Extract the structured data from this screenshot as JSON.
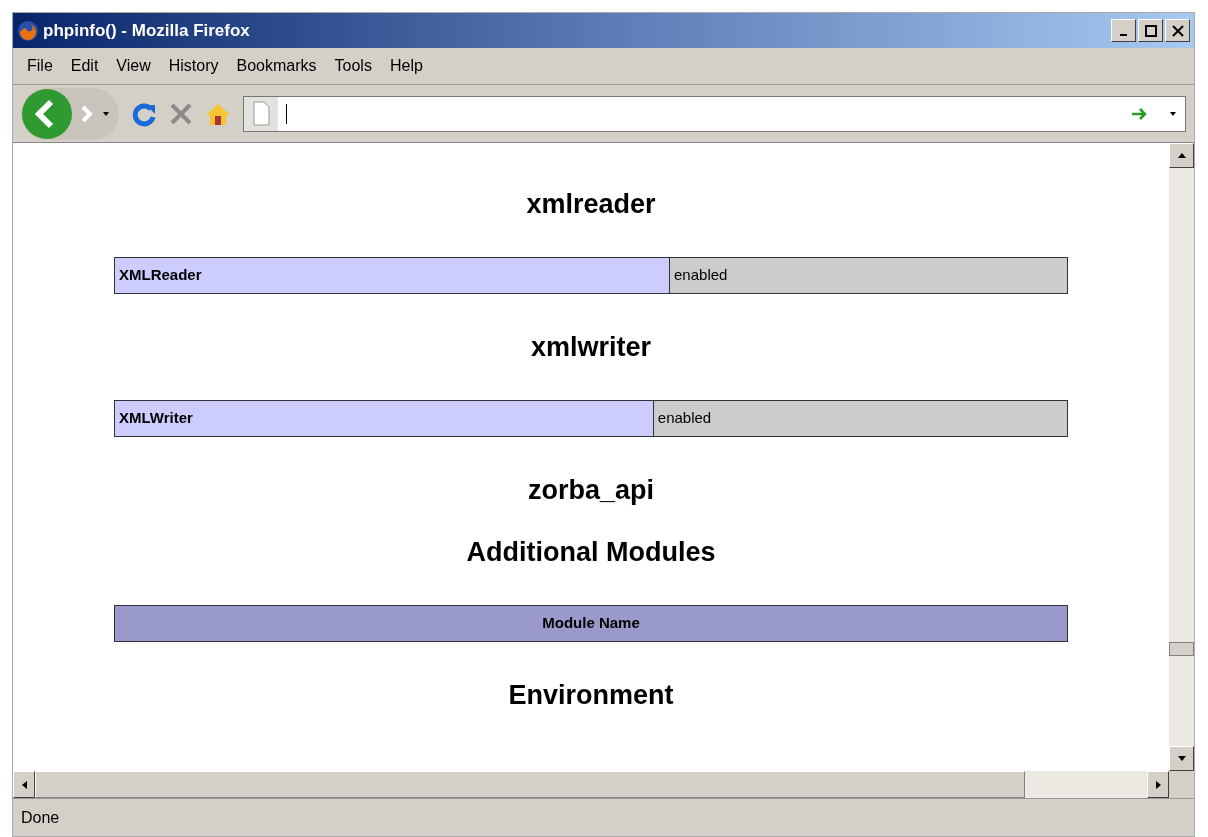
{
  "window": {
    "title": "phpinfo() - Mozilla Firefox"
  },
  "menu": [
    {
      "label": "File"
    },
    {
      "label": "Edit"
    },
    {
      "label": "View"
    },
    {
      "label": "History"
    },
    {
      "label": "Bookmarks"
    },
    {
      "label": "Tools"
    },
    {
      "label": "Help"
    }
  ],
  "content": [
    {
      "kind": "heading",
      "text": "xmlreader"
    },
    {
      "kind": "row",
      "cells": [
        "XMLReader",
        "enabled"
      ]
    },
    {
      "kind": "heading",
      "text": "xmlwriter"
    },
    {
      "kind": "row",
      "cells": [
        "XMLWriter",
        "enabled"
      ]
    },
    {
      "kind": "heading",
      "text": "zorba_api"
    },
    {
      "kind": "heading",
      "text": "Additional Modules"
    },
    {
      "kind": "header",
      "text": "Module Name"
    },
    {
      "kind": "heading",
      "text": "Environment"
    }
  ],
  "status_bar": {
    "text": "Done"
  }
}
